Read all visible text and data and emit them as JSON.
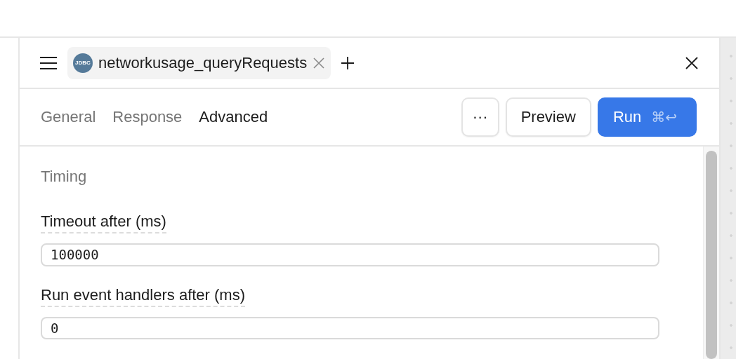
{
  "query_tab": {
    "badge": "JDBC",
    "title": "networkusage_queryRequests"
  },
  "tabs": [
    {
      "label": "General",
      "selected": false
    },
    {
      "label": "Response",
      "selected": false
    },
    {
      "label": "Advanced",
      "selected": true
    }
  ],
  "actions": {
    "more": "···",
    "preview": "Preview",
    "run": "Run",
    "shortcut": "⌘↩"
  },
  "section": {
    "title": "Timing",
    "fields": [
      {
        "label": "Timeout after (ms)",
        "value": "100000"
      },
      {
        "label": "Run event handlers after (ms)",
        "value": "0"
      }
    ]
  }
}
